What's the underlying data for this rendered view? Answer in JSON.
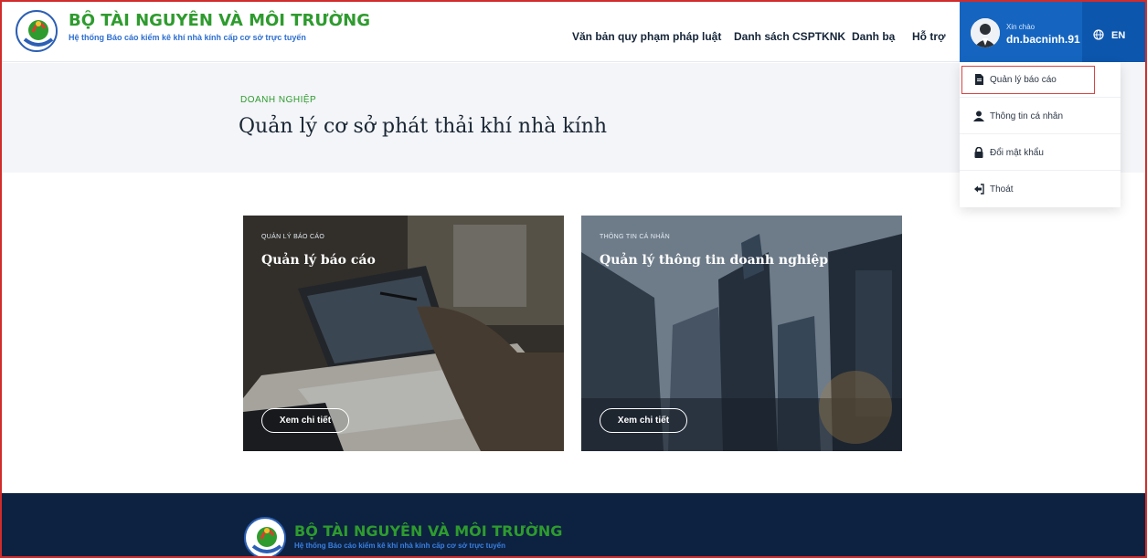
{
  "brand": {
    "title": "BỘ TÀI NGUYÊN VÀ MÔI TRƯỜNG",
    "subtitle": "Hệ thống Báo cáo kiểm kê khí nhà kính cấp cơ sở trực tuyến"
  },
  "nav": {
    "items": [
      {
        "label": "Văn bản quy phạm pháp luật"
      },
      {
        "label": "Danh sách CSPTKNK"
      },
      {
        "label": "Danh bạ"
      },
      {
        "label": "Hỗ trợ"
      }
    ]
  },
  "user": {
    "greeting": "Xin chào",
    "name": "dn.bacninh.91"
  },
  "language": {
    "label": "EN"
  },
  "hero": {
    "kicker": "DOANH NGHIỆP",
    "title": "Quản lý cơ sở phát thải khí nhà kính"
  },
  "cards": [
    {
      "kicker": "QUẢN LÝ BÁO CÁO",
      "title": "Quản lý báo cáo",
      "button": "Xem chi tiết"
    },
    {
      "kicker": "THÔNG TIN CÁ NHÂN",
      "title": "Quản lý thông tin doanh nghiệp",
      "button": "Xem chi tiết"
    }
  ],
  "user_menu": {
    "items": [
      {
        "label": "Quản lý báo cáo",
        "icon": "document-icon"
      },
      {
        "label": "Thông tin cá nhân",
        "icon": "user-icon"
      },
      {
        "label": "Đổi mật khẩu",
        "icon": "lock-icon"
      },
      {
        "label": "Thoát",
        "icon": "logout-icon"
      }
    ]
  },
  "footer": {
    "title": "BỘ TÀI NGUYÊN VÀ MÔI TRƯỜNG",
    "subtitle": "Hệ thống Báo cáo kiểm kê khí nhà kính cấp cơ sở trực tuyến"
  },
  "colors": {
    "primary_blue": "#1565c0",
    "brand_green": "#2e9b2e",
    "footer_navy": "#0d2241",
    "highlight_red": "#d64545"
  }
}
